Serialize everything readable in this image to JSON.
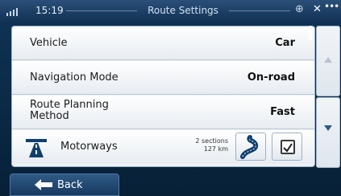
{
  "statusbar": {
    "time": "15:19",
    "title": "Route Settings",
    "gps_icon": "gps-icon",
    "close_icon": "x-icon",
    "menu_icon": "dots-icon"
  },
  "rows": [
    {
      "label": "Vehicle",
      "value": "Car"
    },
    {
      "label": "Navigation Mode",
      "value": "On-road"
    },
    {
      "label": "Route Planning\nMethod",
      "value": "Fast"
    }
  ],
  "motorways": {
    "label": "Motorways",
    "sections": "2 sections",
    "distance": "127 km",
    "checked": true
  },
  "footer": {
    "back_label": "Back"
  },
  "colors": {
    "accent": "#2f5a86",
    "row_bg": "#ffffff"
  }
}
